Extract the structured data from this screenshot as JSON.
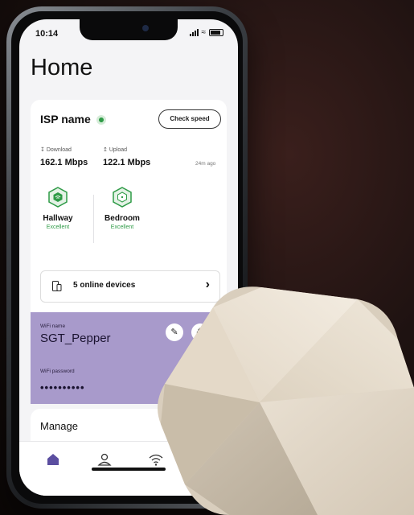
{
  "status_bar": {
    "time": "10:14"
  },
  "page": {
    "title": "Home"
  },
  "isp": {
    "name": "ISP name",
    "check_speed_label": "Check speed"
  },
  "speed": {
    "download_label": "Download",
    "download_value": "162.1 Mbps",
    "upload_label": "Upload",
    "upload_value": "122.1 Mbps",
    "last_checked": "24m ago"
  },
  "nodes": [
    {
      "name": "Hallway",
      "status": "Excellent"
    },
    {
      "name": "Bedroom",
      "status": "Excellent"
    }
  ],
  "devices": {
    "label": "5 online devices"
  },
  "wifi": {
    "name_label": "WiFi name",
    "name": "SGT_Pepper",
    "password_label": "WiFi password",
    "password_masked": "••••••••••"
  },
  "manage": {
    "title": "Manage"
  },
  "tabs": [
    {
      "icon": "home-icon"
    },
    {
      "icon": "person-icon"
    },
    {
      "icon": "wifi-icon"
    }
  ],
  "colors": {
    "accent_purple": "#a89acb",
    "status_green": "#2f9b47",
    "hub_color": "#e6dccd"
  }
}
